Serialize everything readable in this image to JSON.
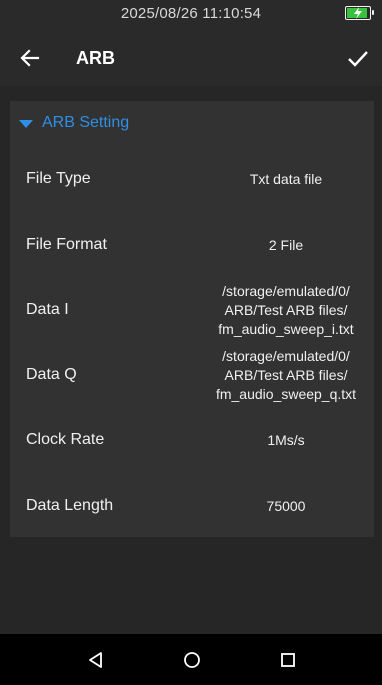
{
  "status_bar": {
    "time": "2025/08/26 11:10:54",
    "battery_level": 0.9,
    "battery_color": "#37c23c",
    "charging": true
  },
  "app_bar": {
    "back_icon": "arrow-left-icon",
    "title": "ARB",
    "confirm_icon": "check-icon"
  },
  "section": {
    "title": "ARB Setting",
    "expanded": true,
    "accent_color": "#2e8fe6"
  },
  "rows": [
    {
      "label": "File Type",
      "value": "Txt data file"
    },
    {
      "label": "File Format",
      "value": "2 File"
    },
    {
      "label": "Data I",
      "value": "/storage/emulated/0/\nARB/Test ARB files/\nfm_audio_sweep_i.txt"
    },
    {
      "label": "Data Q",
      "value": "/storage/emulated/0/\nARB/Test ARB files/\nfm_audio_sweep_q.txt"
    },
    {
      "label": "Clock Rate",
      "value": "1Ms/s"
    },
    {
      "label": "Data Length",
      "value": "75000"
    }
  ],
  "nav_bar": {
    "back_icon": "triangle-back-icon",
    "home_icon": "circle-home-icon",
    "recents_icon": "square-recents-icon"
  }
}
